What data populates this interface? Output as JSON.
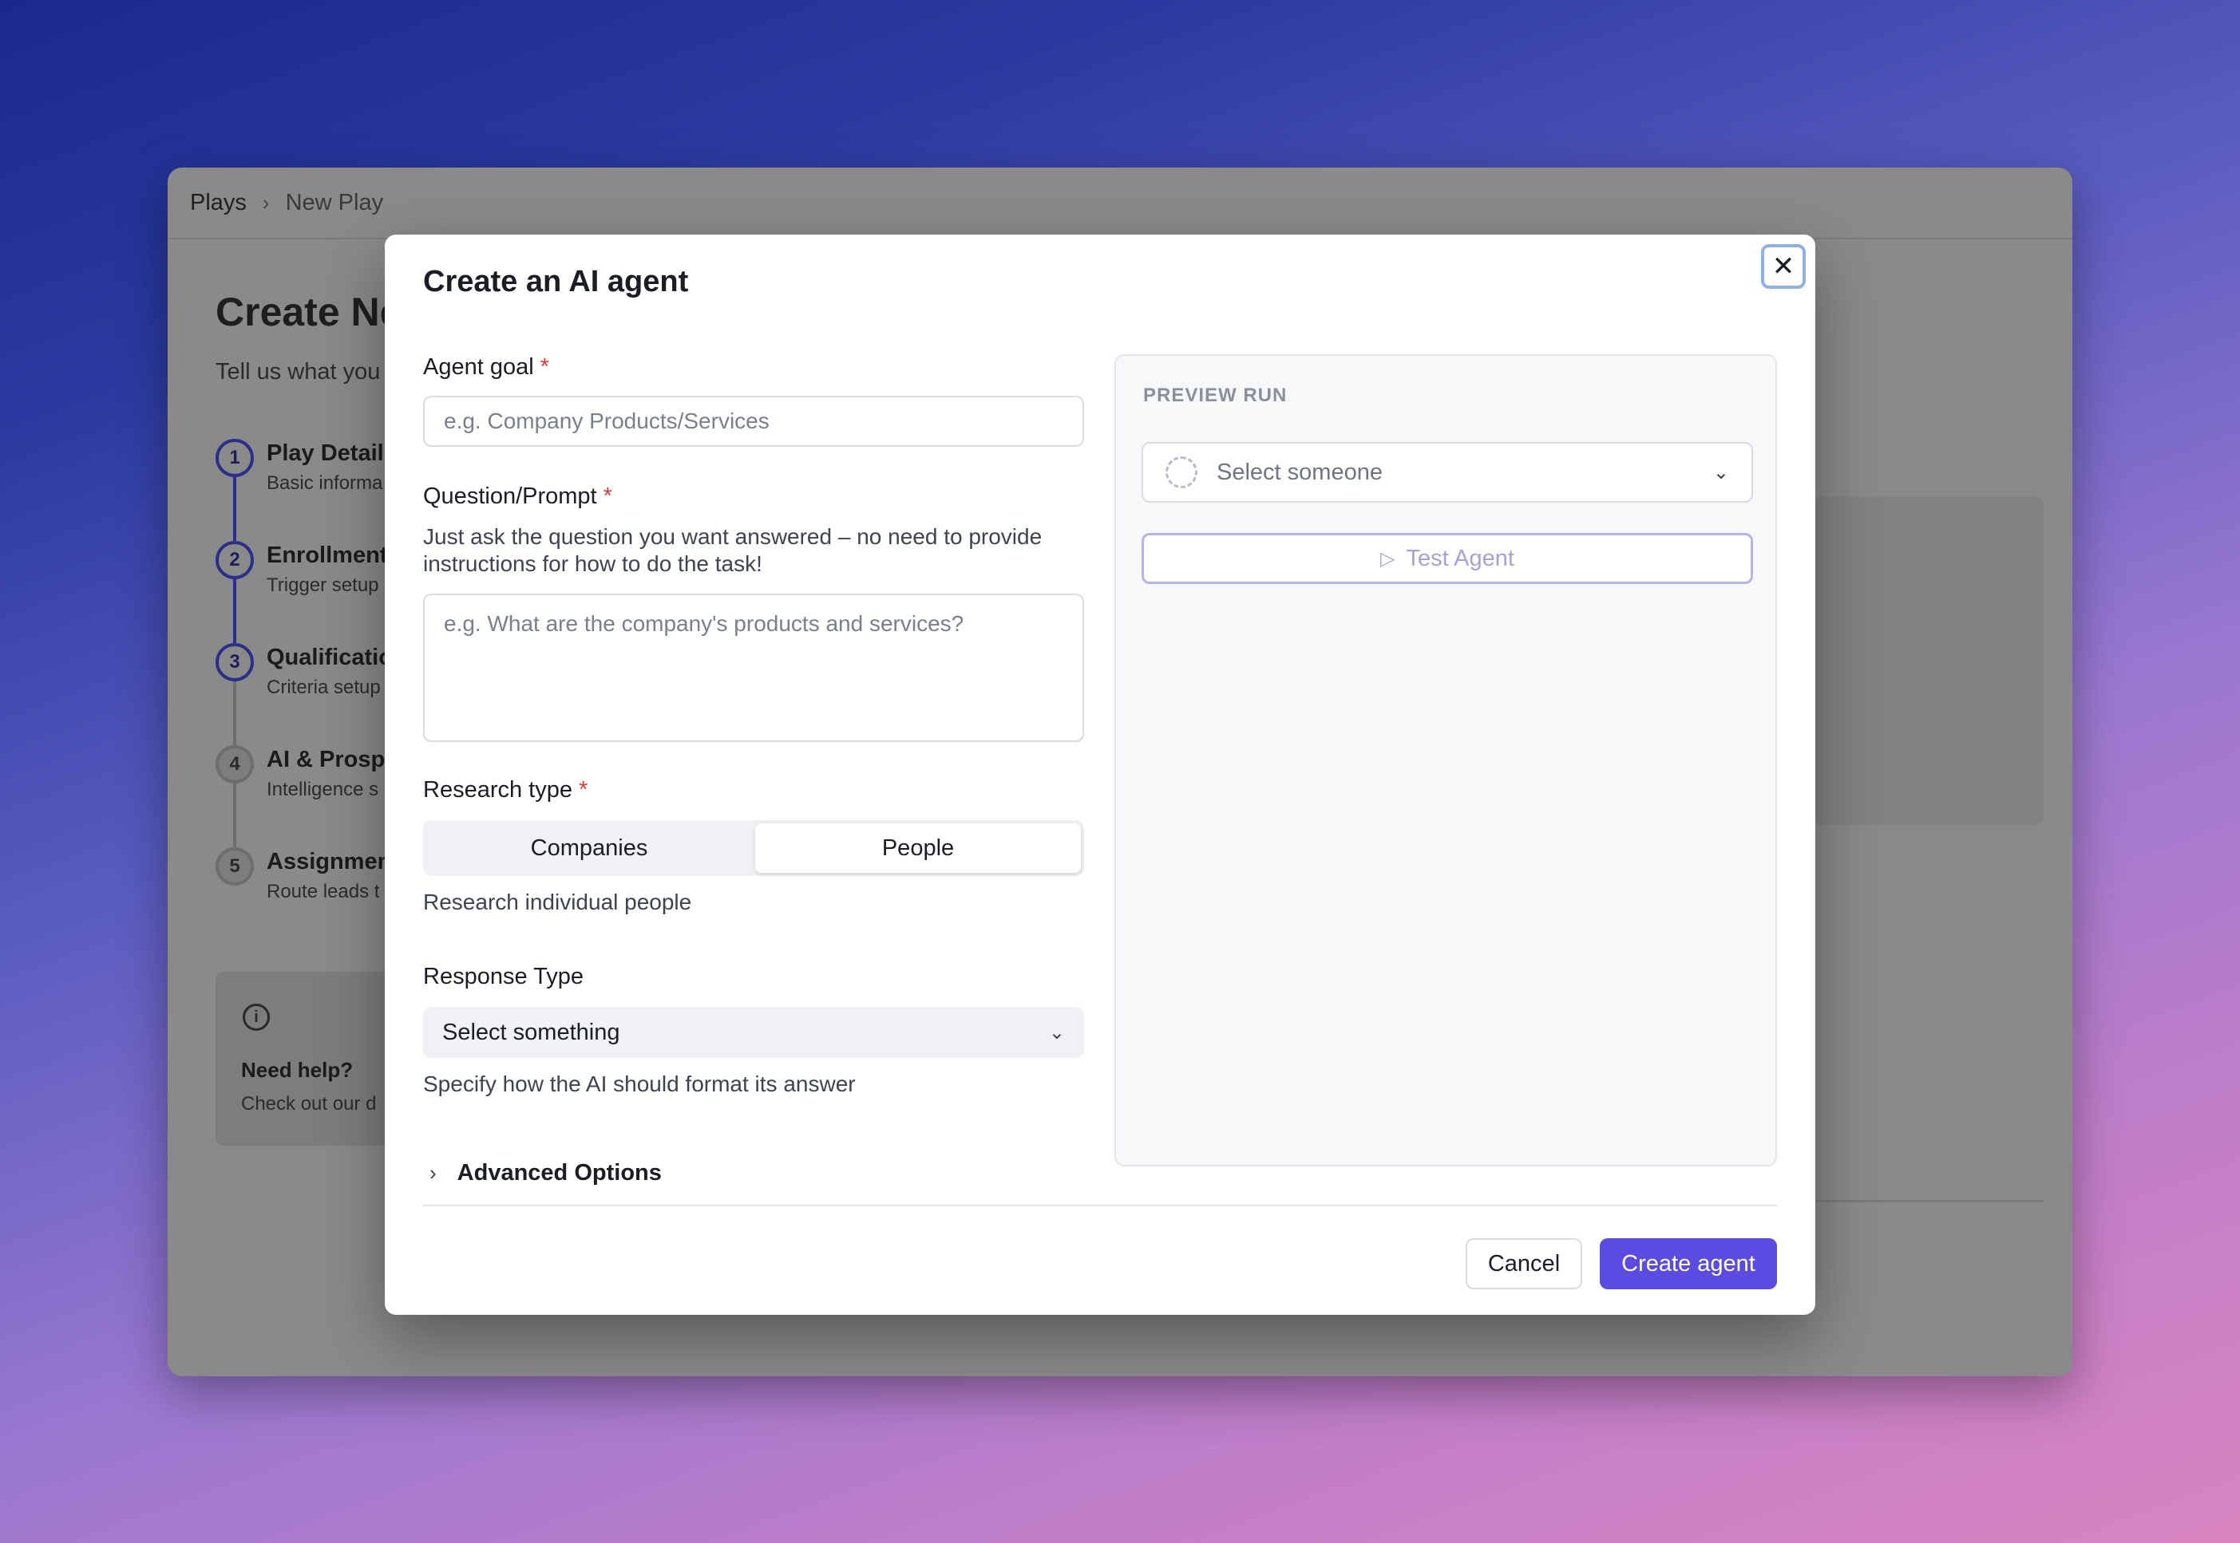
{
  "background_app": {
    "breadcrumb": {
      "root": "Plays",
      "current": "New Play"
    },
    "page_title": "Create Ne",
    "page_subtitle": "Tell us what you",
    "steps": [
      {
        "num": "1",
        "title": "Play Details",
        "subtitle": "Basic informa"
      },
      {
        "num": "2",
        "title": "Enrollment",
        "subtitle": "Trigger setup"
      },
      {
        "num": "3",
        "title": "Qualificatio",
        "subtitle": "Criteria setup"
      },
      {
        "num": "4",
        "title": "AI & Prospe",
        "subtitle": "Intelligence s"
      },
      {
        "num": "5",
        "title": "Assignmen",
        "subtitle": "Route leads t"
      }
    ],
    "help": {
      "title": "Need help?",
      "text": "Check out our d"
    }
  },
  "modal": {
    "title": "Create an AI agent",
    "agent_goal": {
      "label": "Agent goal",
      "required": "*",
      "placeholder": "e.g. Company Products/Services"
    },
    "question": {
      "label": "Question/Prompt",
      "required": "*",
      "help": "Just ask the question you want answered – no need to provide instructions for how to do the task!",
      "placeholder": "e.g. What are the company's products and services?"
    },
    "research_type": {
      "label": "Research type",
      "required": "*",
      "options": [
        "Companies",
        "People"
      ],
      "selected": "People",
      "help": "Research individual people"
    },
    "response_type": {
      "label": "Response Type",
      "value": "Select something",
      "help": "Specify how the AI should format its answer"
    },
    "advanced_label": "Advanced Options",
    "preview": {
      "label": "PREVIEW RUN",
      "select_placeholder": "Select someone",
      "test_button": "Test Agent"
    },
    "buttons": {
      "cancel": "Cancel",
      "create": "Create agent"
    }
  },
  "colors": {
    "accent": "#5b4be0",
    "required": "#d33b3b",
    "close_focus": "#8fb0e4"
  }
}
